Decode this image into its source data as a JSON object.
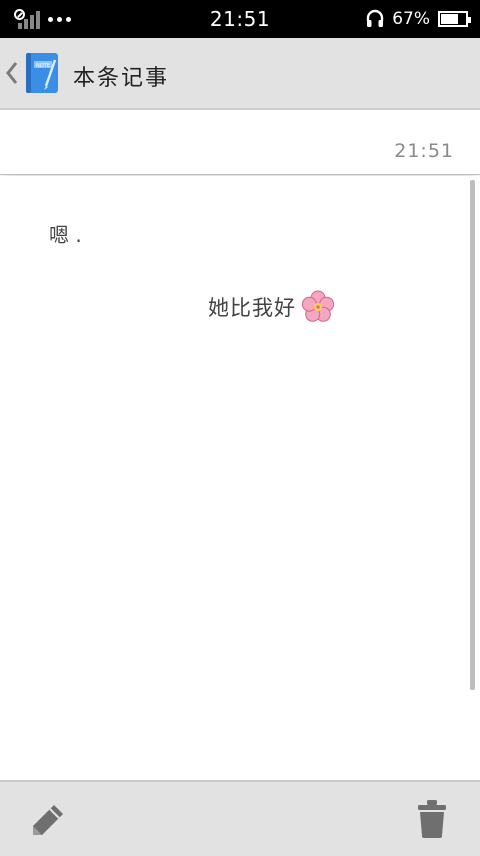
{
  "status_bar": {
    "time": "21:51",
    "battery_percent": "67%",
    "battery_level": 0.67,
    "icons": [
      "no-signal-icon",
      "more-dots-icon",
      "headset-icon",
      "battery-icon"
    ]
  },
  "title_bar": {
    "title": "本条记事",
    "back_icon": "chevron-left-icon",
    "app_icon": "notebook-icon"
  },
  "note": {
    "timestamp": "21:51",
    "lines": [
      "嗯 .",
      "她比我好"
    ]
  },
  "bottom_bar": {
    "edit_icon": "pencil-icon",
    "delete_icon": "trash-icon"
  },
  "colors": {
    "bar_background": "#e2e2e2",
    "status_background": "#000000",
    "accent_blue": "#3a8ee6"
  }
}
